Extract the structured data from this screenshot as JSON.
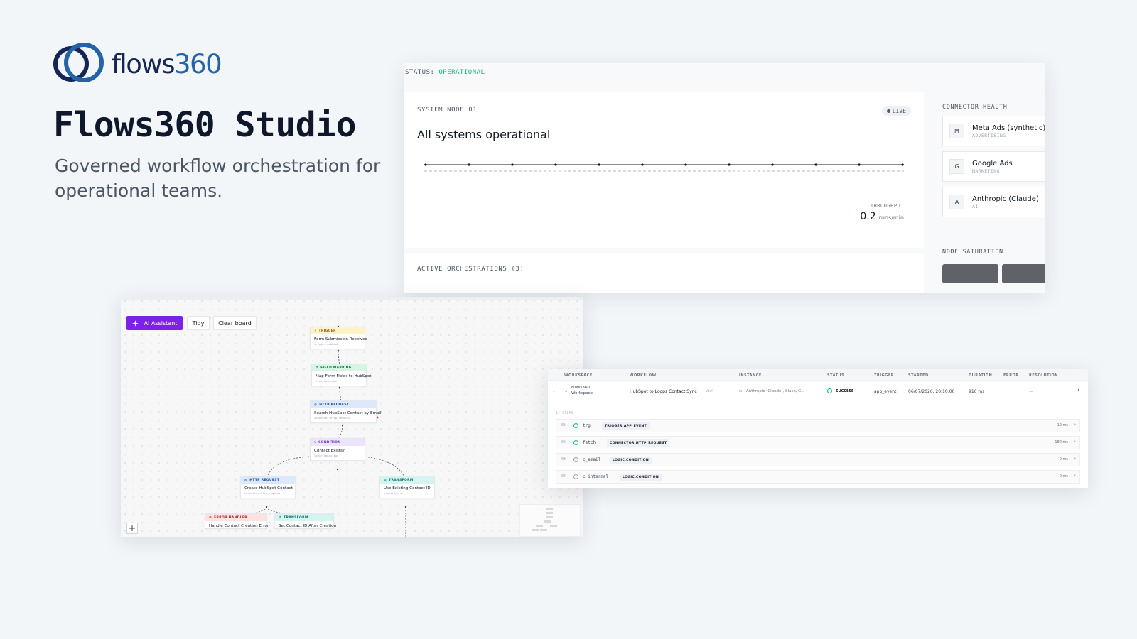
{
  "hero": {
    "logo_word_a": "flows",
    "logo_word_b": "360",
    "title": "Flows360 Studio",
    "subtitle": "Governed workflow orchestration for operational teams."
  },
  "dashboard": {
    "status_label": "STATUS:",
    "status_value": "OPERATIONAL",
    "node_label": "SYSTEM NODE 01",
    "live_badge": "LIVE",
    "node_title": "All systems operational",
    "throughput_label": "THROUGHPUT",
    "throughput_value": "0.2",
    "throughput_unit": "runs/min",
    "active_label": "ACTIVE ORCHESTRATIONS (3)",
    "connector_health_label": "CONNECTOR HEALTH",
    "connectors": [
      {
        "initial": "M",
        "name": "Meta Ads (synthetic)",
        "category": "ADVERTISING"
      },
      {
        "initial": "G",
        "name": "Google Ads",
        "category": "MARKETING"
      },
      {
        "initial": "A",
        "name": "Anthropic (Claude)",
        "category": "AI"
      }
    ],
    "node_saturation_label": "NODE SATURATION",
    "colors": {
      "ok": "#10b981"
    }
  },
  "canvas": {
    "ai_button": "AI Assistant",
    "tidy_button": "Tidy",
    "clear_button": "Clear board",
    "zoom_in": "+",
    "nodes": [
      {
        "type": "TRIGGER",
        "name": "Form Submission Received",
        "sub": "trigger.webhook"
      },
      {
        "type": "FIELD MAPPING",
        "name": "Map Form Fields to HubSpot",
        "sub": "transform.map"
      },
      {
        "type": "HTTP REQUEST",
        "name": "Search HubSpot Contact by Email",
        "sub": "connector.http_request"
      },
      {
        "type": "CONDITION",
        "name": "Contact Exists?",
        "sub": "logic.condition"
      },
      {
        "type": "HTTP REQUEST",
        "name": "Create HubSpot Contact",
        "sub": "connector.http_request"
      },
      {
        "type": "TRANSFORM",
        "name": "Use Existing Contact ID",
        "sub": "transform.set"
      },
      {
        "type": "ERROR HANDLER",
        "name": "Handle Contact Creation Error",
        "sub": ""
      },
      {
        "type": "TRANSFORM",
        "name": "Set Contact ID After Creation",
        "sub": ""
      }
    ]
  },
  "runs": {
    "headers": [
      "WORKSPACE",
      "WORKFLOW",
      "INSTANCE",
      "STATUS",
      "TRIGGER",
      "STARTED",
      "DURATION",
      "ERROR",
      "RESOLUTION"
    ],
    "row": {
      "workspace_a": "Flows360",
      "workspace_b": "Workspace",
      "workflow": "HubSpot to Loops Contact Sync",
      "version": "V107",
      "instance": "Anthropic (Claude), Slack, G...",
      "status": "SUCCESS",
      "trigger": "app_event",
      "started": "06/07/2026, 20:10:00",
      "duration": "916 ms",
      "error": "",
      "resolution": "—"
    },
    "steps_label": "11 STEPS",
    "steps": [
      {
        "idx": "01",
        "name": "trg",
        "tag": "TRIGGER.APP_EVENT",
        "duration": "19 ms",
        "ok": true
      },
      {
        "idx": "02",
        "name": "fetch",
        "tag": "CONNECTOR.HTTP_REQUEST",
        "duration": "180 ms",
        "ok": true
      },
      {
        "idx": "03",
        "name": "c_email",
        "tag": "LOGIC.CONDITION",
        "duration": "0 ms",
        "ok": false
      },
      {
        "idx": "04",
        "name": "c_internal",
        "tag": "LOGIC.CONDITION",
        "duration": "0 ms",
        "ok": false
      }
    ]
  }
}
